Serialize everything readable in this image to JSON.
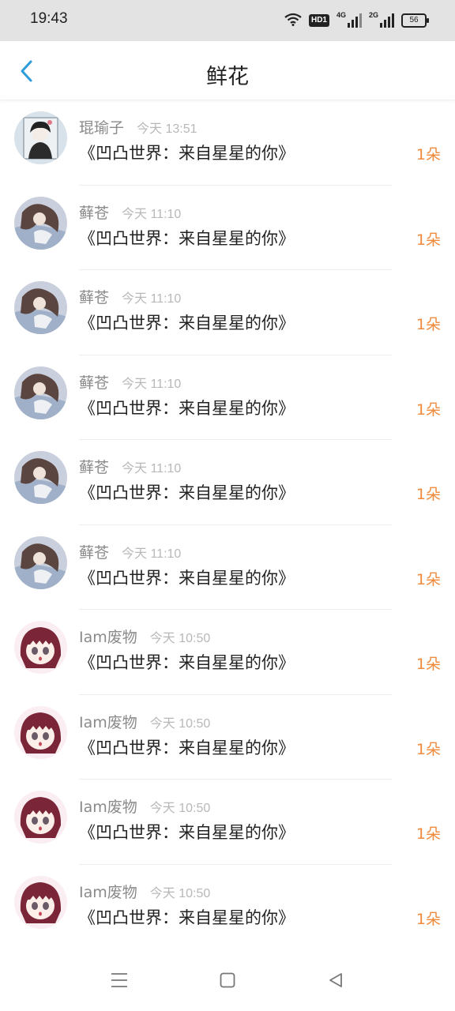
{
  "status": {
    "time": "19:43",
    "hd": "HD1",
    "net1": "4G",
    "net2": "2G",
    "battery": "56"
  },
  "header": {
    "title": "鲜花"
  },
  "icons": {
    "back": "chevron-left-icon",
    "menu": "menu-icon",
    "home": "home-square-icon",
    "back_nav": "triangle-back-icon",
    "wifi": "wifi-icon",
    "hd": "hd-icon",
    "signal": "signal-icon",
    "battery": "battery-icon"
  },
  "colors": {
    "accent": "#2e9cdb",
    "count": "#f08a3c",
    "name": "#8a8a8a",
    "time": "#b8b8b8"
  },
  "items": [
    {
      "name": "琨瑜子",
      "time": "今天 13:51",
      "gift": "《凹凸世界：来自星星的你》",
      "count": "1朵",
      "avatar": "avatar-boy-icon"
    },
    {
      "name": "藓苍",
      "time": "今天 11:10",
      "gift": "《凹凸世界：来自星星的你》",
      "count": "1朵",
      "avatar": "avatar-girl-longhair-icon"
    },
    {
      "name": "藓苍",
      "time": "今天 11:10",
      "gift": "《凹凸世界：来自星星的你》",
      "count": "1朵",
      "avatar": "avatar-girl-longhair-icon"
    },
    {
      "name": "藓苍",
      "time": "今天 11:10",
      "gift": "《凹凸世界：来自星星的你》",
      "count": "1朵",
      "avatar": "avatar-girl-longhair-icon"
    },
    {
      "name": "藓苍",
      "time": "今天 11:10",
      "gift": "《凹凸世界：来自星星的你》",
      "count": "1朵",
      "avatar": "avatar-girl-longhair-icon"
    },
    {
      "name": "藓苍",
      "time": "今天 11:10",
      "gift": "《凹凸世界：来自星星的你》",
      "count": "1朵",
      "avatar": "avatar-girl-longhair-icon"
    },
    {
      "name": "Iam废物",
      "time": "今天 10:50",
      "gift": "《凹凸世界：来自星星的你》",
      "count": "1朵",
      "avatar": "avatar-girl-bangs-icon"
    },
    {
      "name": "Iam废物",
      "time": "今天 10:50",
      "gift": "《凹凸世界：来自星星的你》",
      "count": "1朵",
      "avatar": "avatar-girl-bangs-icon"
    },
    {
      "name": "Iam废物",
      "time": "今天 10:50",
      "gift": "《凹凸世界：来自星星的你》",
      "count": "1朵",
      "avatar": "avatar-girl-bangs-icon"
    },
    {
      "name": "Iam废物",
      "time": "今天 10:50",
      "gift": "《凹凸世界：来自星星的你》",
      "count": "1朵",
      "avatar": "avatar-girl-bangs-icon"
    }
  ]
}
